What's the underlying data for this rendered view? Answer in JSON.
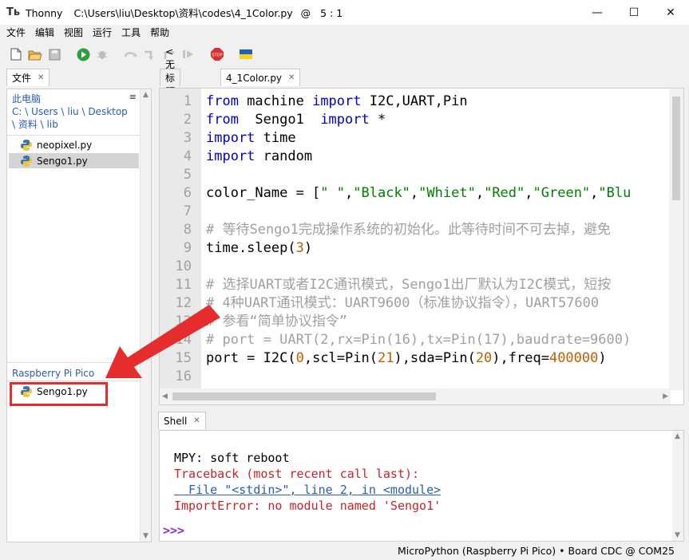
{
  "window": {
    "app_name": "Thonny",
    "path_title": "C:\\Users\\liu\\Desktop\\资料\\codes\\4_1Color.py",
    "at": "@",
    "cursor_pos": "5 : 1",
    "minimize": "—",
    "maximize": "☐",
    "close": "✕"
  },
  "menu": [
    "文件",
    "编辑",
    "视图",
    "运行",
    "工具",
    "帮助"
  ],
  "left_panel": {
    "tab_label": "文件",
    "this_pc": "此电脑",
    "path_line1": "C: \\ Users \\ liu \\ Desktop",
    "path_line2": "\\ 资料 \\ lib",
    "local_files": [
      "neopixel.py",
      "Sengo1.py"
    ],
    "device_head": "Raspberry Pi Pico",
    "device_files": [
      "Sengo1.py"
    ]
  },
  "editor": {
    "tabs": [
      "<无标题>",
      "4_1Color.py"
    ],
    "line_numbers": [
      "1",
      "2",
      "3",
      "4",
      "5",
      "6",
      "7",
      "8",
      "9",
      "10",
      "11",
      "12",
      "13",
      "14",
      "15",
      "16"
    ],
    "lines": {
      "l1_kw1": "from",
      "l1_mod": " machine ",
      "l1_kw2": "import",
      "l1_rest": " I2C,UART,Pin",
      "l2_kw1": "from",
      "l2_mod": "  Sengo1  ",
      "l2_kw2": "import",
      "l2_rest": " *",
      "l3_kw": "import",
      "l3_rest": " time",
      "l4_kw": "import",
      "l4_rest": " random",
      "l6_a": "color_Name = [",
      "l6_s1": "\" \"",
      "l6_c1": ",",
      "l6_s2": "\"Black\"",
      "l6_c2": ",",
      "l6_s3": "\"Whiet\"",
      "l6_c3": ",",
      "l6_s4": "\"Red\"",
      "l6_c4": ",",
      "l6_s5": "\"Green\"",
      "l6_c5": ",",
      "l6_s6": "\"Blu",
      "l8_cm": "# 等待Sengo1完成操作系统的初始化。此等待时间不可去掉，避免",
      "l9_a": "time.sleep(",
      "l9_n": "3",
      "l9_b": ")",
      "l11_cm": "# 选择UART或者I2C通讯模式，Sengo1出厂默认为I2C模式，短按",
      "l12_cm": "# 4种UART通讯模式：UART9600（标准协议指令），UART57600",
      "l13_cm": "# 参看“简单协议指令”",
      "l14_cm": "# port = UART(2,rx=Pin(16),tx=Pin(17),baudrate=9600)",
      "l15_a": "port = I2C(",
      "l15_n1": "0",
      "l15_b": ",scl=Pin(",
      "l15_n2": "21",
      "l15_c": "),sda=Pin(",
      "l15_n3": "20",
      "l15_d": "),freq=",
      "l15_n4": "400000",
      "l15_e": ")"
    }
  },
  "shell": {
    "tab_label": "Shell",
    "lines": [
      "MPY: soft reboot",
      "Traceback (most recent call last):",
      "  File \"<stdin>\", line 2, in <module>",
      "ImportError: no module named 'Sengo1'"
    ],
    "prompt": ">>>"
  },
  "status": {
    "text": "MicroPython (Raspberry Pi Pico)  •  Board CDC @ COM25"
  },
  "colors": {
    "annotation_red": "#e62d2d",
    "link_blue": "#2a5db0",
    "error_red": "#c8232b"
  }
}
